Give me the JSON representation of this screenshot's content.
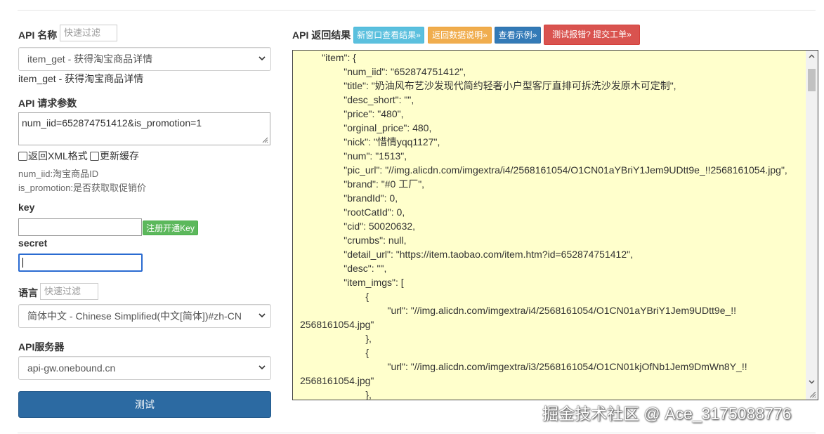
{
  "left": {
    "api_name_label": "API 名称",
    "api_name_filter_placeholder": "快速过滤",
    "api_select_value": "item_get - 获得淘宝商品详情",
    "api_description": "item_get - 获得淘宝商品详情",
    "params_label": "API 请求参数",
    "params_value": "num_iid=652874751412&is_promotion=1",
    "return_xml_label": "返回XML格式",
    "refresh_cache_label": "更新缓存",
    "help_lines": [
      "num_iid:淘宝商品ID",
      "is_promotion:是否获取取促销价"
    ],
    "key_label": "key",
    "register_key_button": "注册开通Key",
    "secret_label": "secret",
    "language_label": "语言",
    "language_filter_placeholder": "快速过滤",
    "language_select_value": "简体中文 - Chinese Simplified(中文[简体])#zh-CN",
    "server_label": "API服务器",
    "server_select_value": "api-gw.onebound.cn",
    "test_button": "测试"
  },
  "right": {
    "result_label": "API 返回结果",
    "buttons": [
      {
        "label": "新窗口查看结果»",
        "color": "#5bc0de"
      },
      {
        "label": "返回数据说明»",
        "color": "#f0ad4e"
      },
      {
        "label": "查看示例»",
        "color": "#337ab7"
      },
      {
        "label": "测试报错? 提交工单»",
        "color": "#d9534f"
      }
    ],
    "code_lines": [
      "        \"item\": {",
      "                \"num_iid\": \"652874751412\",",
      "                \"title\": \"奶油风布艺沙发现代简约轻奢小户型客厅直排可拆洗沙发原木可定制\",",
      "                \"desc_short\": \"\",",
      "                \"price\": \"480\",",
      "                \"orginal_price\": 480,",
      "                \"nick\": \"惜情yqq1127\",",
      "                \"num\": \"1513\",",
      "                \"pic_url\": \"//img.alicdn.com/imgextra/i4/2568161054/O1CN01aYBriY1Jem9UDtt9e_!!2568161054.jpg\",",
      "                \"brand\": \"#0 工厂\",",
      "                \"brandId\": 0,",
      "                \"rootCatId\": 0,",
      "                \"cid\": 50020632,",
      "                \"crumbs\": null,",
      "                \"detail_url\": \"https://item.taobao.com/item.htm?id=652874751412\",",
      "                \"desc\": \"\",",
      "                \"item_imgs\": [",
      "                        {",
      "                                \"url\": \"//img.alicdn.com/imgextra/i4/2568161054/O1CN01aYBriY1Jem9UDtt9e_!!",
      "2568161054.jpg\"",
      "                        },",
      "                        {",
      "                                \"url\": \"//img.alicdn.com/imgextra/i3/2568161054/O1CN01kjOfNb1Jem9DmWn8Y_!!",
      "2568161054.jpg\"",
      "                        },"
    ]
  },
  "watermark": "掘金技术社区 @ Ace_3175088776"
}
